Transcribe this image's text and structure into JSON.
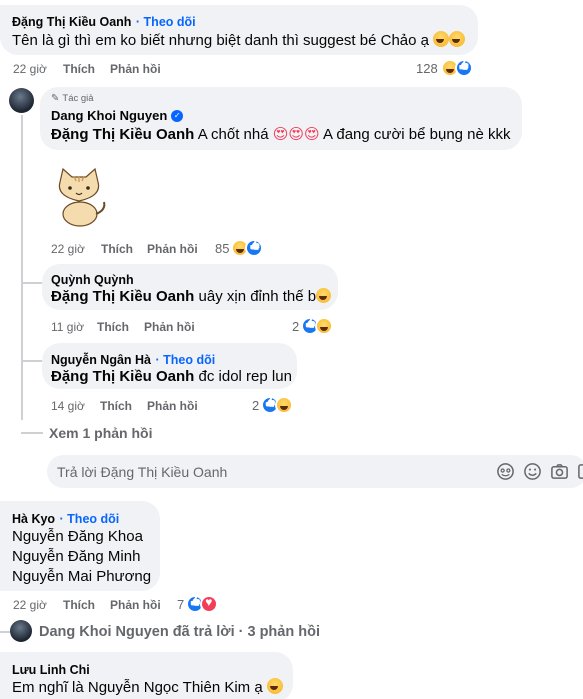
{
  "comments": [
    {
      "author": "Đặng Thị Kiều Oanh",
      "follow": "Theo dõi",
      "text": "Tên là gì thì em ko biết nhưng biệt danh thì suggest bé Chảo ạ",
      "time": "22 giờ",
      "like": "Thích",
      "reply": "Phản hồi",
      "reaction_count": "128",
      "reactions": [
        "haha",
        "like"
      ]
    },
    {
      "badge": "Tác giả",
      "author": "Dang Khoi Nguyen",
      "mention": "Đặng Thị Kiều Oanh",
      "text_a": "A chốt nhá",
      "text_b": "A đang cười bể bụng nè kkk",
      "sticker": "cat-sticker",
      "time": "22 giờ",
      "like": "Thích",
      "reply": "Phản hồi",
      "reaction_count": "85",
      "reactions": [
        "haha",
        "like"
      ]
    },
    {
      "author": "Quỳnh Quỳnh",
      "mention": "Đặng Thị Kiều Oanh",
      "text": "uây xịn đỉnh thế b",
      "time": "11 giờ",
      "like": "Thích",
      "reply": "Phản hồi",
      "reaction_count": "2",
      "reactions": [
        "like",
        "haha"
      ]
    },
    {
      "author": "Nguyễn Ngân Hà",
      "follow": "Theo dõi",
      "mention": "Đặng Thị Kiều Oanh",
      "text": "đc idol rep lun",
      "time": "14 giờ",
      "like": "Thích",
      "reply": "Phản hồi",
      "reaction_count": "2",
      "reactions": [
        "like",
        "haha"
      ]
    }
  ],
  "view_more": "Xem 1 phản hồi",
  "reply_input": {
    "placeholder": "Trả lời Đặng Thị Kiều Oanh"
  },
  "comment_ha_kyo": {
    "author": "Hà Kyo",
    "follow": "Theo dõi",
    "lines": [
      "Nguyễn Đăng Khoa",
      "Nguyễn Đăng Minh",
      "Nguyễn Mai Phương"
    ],
    "time": "22 giờ",
    "like": "Thích",
    "reply": "Phản hồi",
    "reaction_count": "7",
    "reactions": [
      "like",
      "love"
    ]
  },
  "replied_summary": "Dang Khoi Nguyen đã trả lời · 3 phản hồi",
  "comment_linh_chi": {
    "author": "Lưu Linh Chi",
    "text": "Em nghĩ là Nguyễn Ngọc Thiên Kim ạ"
  },
  "colors": {
    "bubble": "#f0f2f5",
    "link": "#0866ff",
    "meta": "#65676b",
    "like": "#1877f2",
    "love": "#f33e58"
  }
}
